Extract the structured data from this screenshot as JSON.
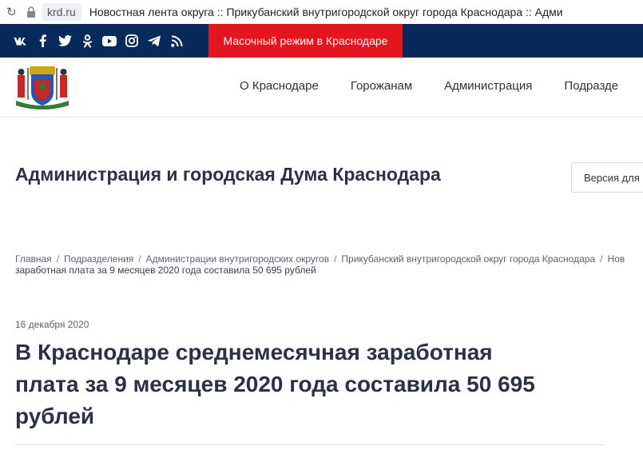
{
  "browser": {
    "domain": "krd.ru",
    "tab_title": "Новостная лента округа :: Прикубанский внутригородской округ города Краснодара :: Адми"
  },
  "topbar": {
    "social_icons": [
      "vk-icon",
      "facebook-icon",
      "twitter-icon",
      "odnoklassniki-icon",
      "youtube-icon",
      "instagram-icon",
      "telegram-icon",
      "rss-icon"
    ],
    "mask_mode_label": "Масочный режим в Краснодаре",
    "bg_color": "#062b5a",
    "accent_color": "#e4151f"
  },
  "nav": {
    "items": [
      "О Краснодаре",
      "Горожанам",
      "Администрация",
      "Подразде"
    ]
  },
  "site": {
    "title": "Администрация и городская Дума Краснодара",
    "version_button": "Версия для"
  },
  "breadcrumb": {
    "items": [
      "Главная",
      "Подразделения",
      "Администрации внутригородских округов",
      "Прикубанский внутригородской округ города Краснодара",
      "Нов"
    ],
    "current": "заработная плата за 9 месяцев 2020 года составила 50 695 рублей"
  },
  "article": {
    "date": "16 декабря 2020",
    "headline_lines": [
      "В Краснодаре среднемесячная заработная",
      "плата за 9 месяцев 2020 года составила 50 695",
      "рублей"
    ]
  }
}
